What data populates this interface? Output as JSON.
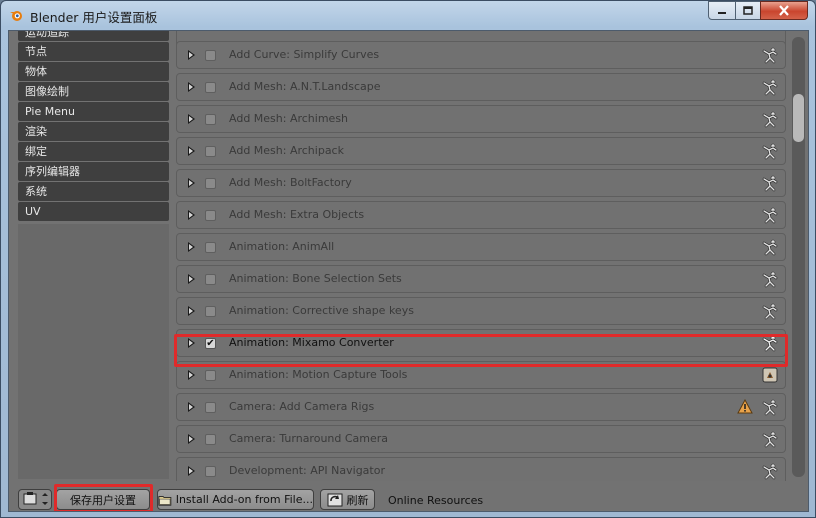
{
  "window": {
    "title": "Blender 用户设置面板",
    "controls": [
      "minimize-icon",
      "maximize-icon",
      "close-icon"
    ]
  },
  "sidebar": {
    "items": [
      {
        "label": "运动追踪"
      },
      {
        "label": "节点"
      },
      {
        "label": "物体"
      },
      {
        "label": "图像绘制"
      },
      {
        "label": "Pie Menu"
      },
      {
        "label": "渲染"
      },
      {
        "label": "绑定"
      },
      {
        "label": "序列编辑器"
      },
      {
        "label": "系统"
      },
      {
        "label": "UV"
      }
    ]
  },
  "addons": {
    "rows": [
      {
        "label": "Add Curve: Simplify Curves",
        "enabled": false,
        "icon": "user-icon"
      },
      {
        "label": "Add Mesh: A.N.T.Landscape",
        "enabled": false,
        "icon": "user-icon"
      },
      {
        "label": "Add Mesh: Archimesh",
        "enabled": false,
        "icon": "user-icon"
      },
      {
        "label": "Add Mesh: Archipack",
        "enabled": false,
        "icon": "user-icon"
      },
      {
        "label": "Add Mesh: BoltFactory",
        "enabled": false,
        "icon": "user-icon"
      },
      {
        "label": "Add Mesh: Extra Objects",
        "enabled": false,
        "icon": "user-icon"
      },
      {
        "label": "Animation: AnimAll",
        "enabled": false,
        "icon": "user-icon"
      },
      {
        "label": "Animation: Bone Selection Sets",
        "enabled": false,
        "icon": "user-icon"
      },
      {
        "label": "Animation: Corrective shape keys",
        "enabled": false,
        "icon": "user-icon"
      },
      {
        "label": "Animation: Mixamo Converter",
        "enabled": true,
        "icon": "user-icon"
      },
      {
        "label": "Animation: Motion Capture Tools",
        "enabled": false,
        "icon": "plugin-icon"
      },
      {
        "label": "Camera: Add Camera Rigs",
        "enabled": false,
        "icon": "user-icon",
        "warning": true
      },
      {
        "label": "Camera: Turnaround Camera",
        "enabled": false,
        "icon": "user-icon"
      },
      {
        "label": "Development: API Navigator",
        "enabled": false,
        "icon": "user-icon"
      }
    ]
  },
  "bottom": {
    "save_label": "保存用户设置",
    "install_label": "Install Add-on from File...",
    "refresh_label": "刷新",
    "online_label": "Online Resources"
  },
  "colors": {
    "highlight": "#e02a2a",
    "panel": "#727272",
    "sidebar_item": "#3f3f3f",
    "title_gradient": "#a9c3dd"
  }
}
